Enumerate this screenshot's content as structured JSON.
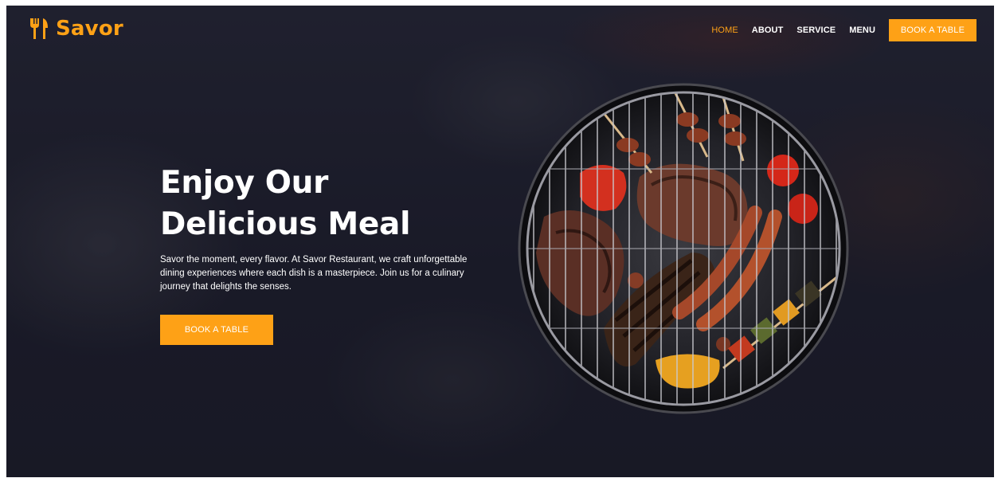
{
  "brand": {
    "name": "Savor",
    "icon": "utensils-icon",
    "accent": "#fea116"
  },
  "nav": {
    "links": [
      {
        "label": "HOME",
        "active": true
      },
      {
        "label": "ABOUT",
        "active": false
      },
      {
        "label": "SERVICE",
        "active": false
      },
      {
        "label": "MENU",
        "active": false
      }
    ],
    "cta": "BOOK A TABLE"
  },
  "hero": {
    "title_line1": "Enjoy Our",
    "title_line2": "Delicious Meal",
    "description": "Savor the moment, every flavor. At Savor Restaurant, we craft unforgettable dining experiences where each dish is a masterpiece. Join us for a culinary journey that delights the senses.",
    "cta": "BOOK A TABLE",
    "image": "bbq-grill-image"
  }
}
